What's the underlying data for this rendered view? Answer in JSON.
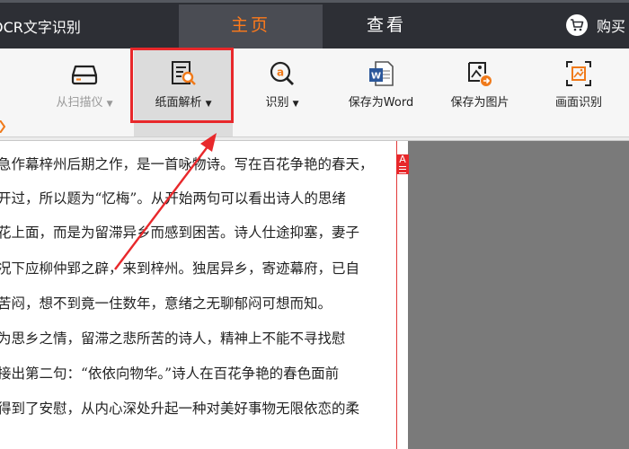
{
  "app": {
    "title": "OCR文字识别"
  },
  "nav": {
    "tabs": [
      {
        "label": "主页"
      },
      {
        "label": "查看"
      }
    ]
  },
  "cart": {
    "label": "购买",
    "icon": "shopping-cart-icon"
  },
  "toolbar": {
    "items": [
      {
        "label": "从扫描仪",
        "dropdown": true,
        "icon": "scanner-icon",
        "disabled": true
      },
      {
        "label": "纸面解析",
        "dropdown": true,
        "icon": "page-analysis-icon",
        "active": true
      },
      {
        "label": "识别",
        "dropdown": true,
        "icon": "recognize-icon"
      },
      {
        "label": "保存为Word",
        "icon": "word-icon"
      },
      {
        "label": "保存为图片",
        "icon": "save-image-icon"
      },
      {
        "label": "画面识别",
        "icon": "screen-recognition-icon"
      }
    ],
    "dropdown_glyph": "▼"
  },
  "document": {
    "marker": "A",
    "lines": [
      "急作幕梓州后期之作，是一首咏物诗。写在百花争艳的春天，",
      "开过，所以题为“忆梅”。从开始两句可以看出诗人的思绪",
      "花上面，而是为留滞异乡而感到困苦。诗人仕途抑塞，妻子",
      "况下应柳仲郢之辟，来到梓州。独居异乡，寄迹幕府，已自",
      "苦闷，想不到竟一住数年，意绪之无聊郁闷可想而知。",
      "为思乡之情，留滞之悲所苦的诗人，精神上不能不寻找慰",
      "接出第二句：“依依向物华。”诗人在百花争艳的春色面前",
      "得到了安慰，从内心深处升起一种对美好事物无限依恋的柔"
    ]
  },
  "colors": {
    "accent_orange": "#ff7a1a",
    "titlebar": "#2d2f35",
    "highlight_red": "#e8282b",
    "word_blue": "#2b579a",
    "icon_orange": "#f07a1a"
  }
}
